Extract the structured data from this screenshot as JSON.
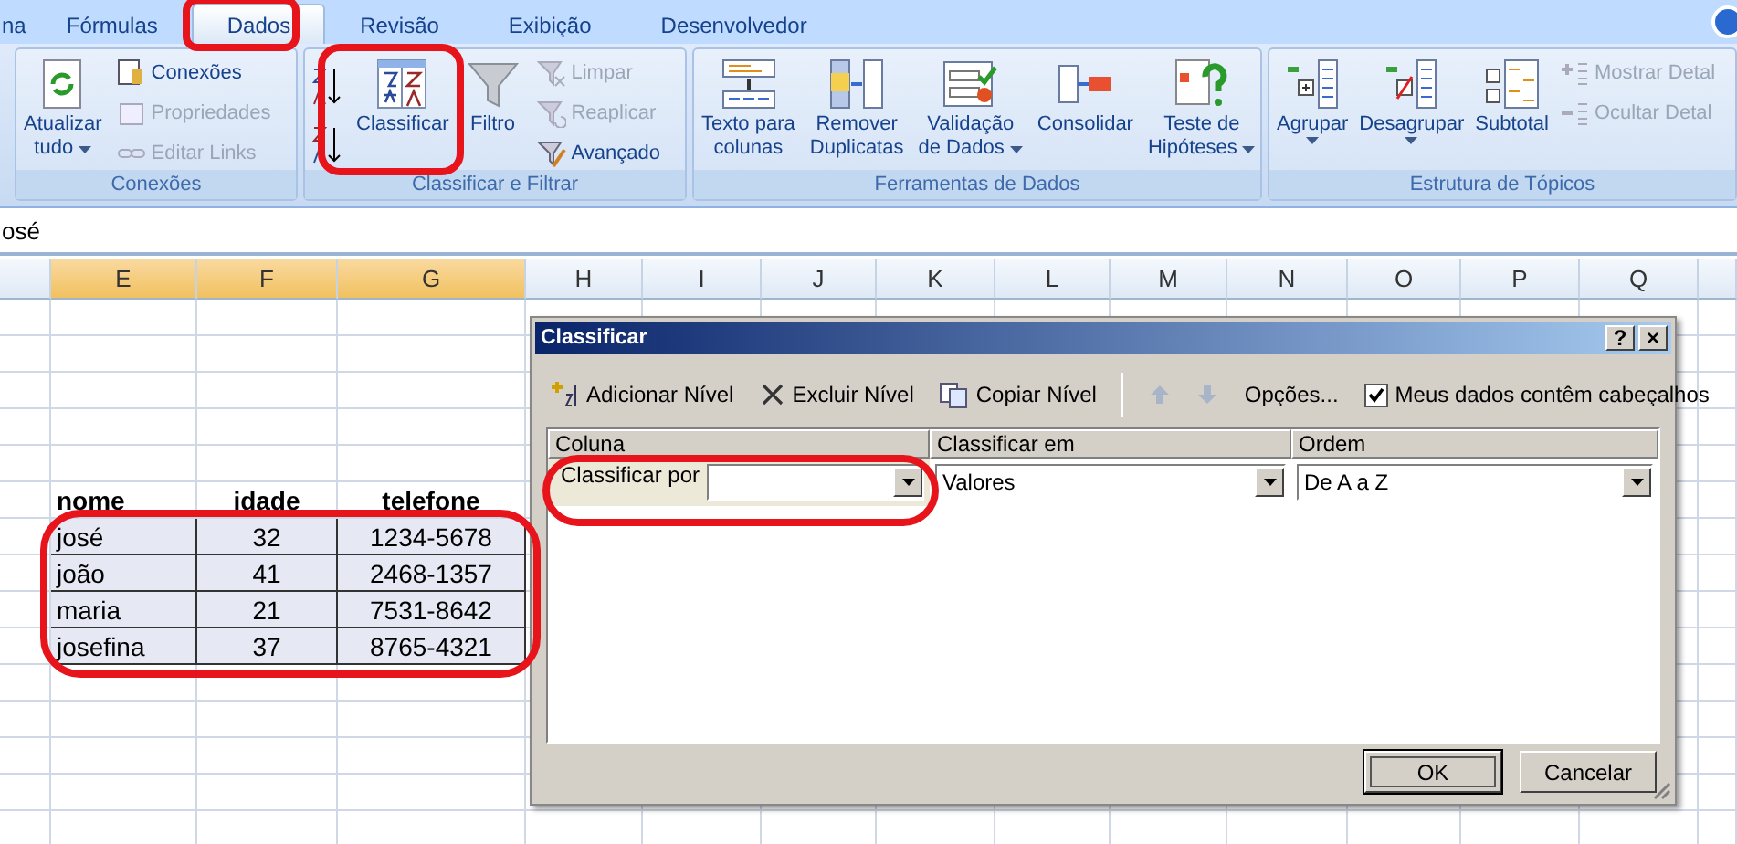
{
  "ribbon_tabs": [
    {
      "label": "na",
      "selected": false
    },
    {
      "label": "Fórmulas",
      "selected": false
    },
    {
      "label": "Dados",
      "selected": true
    },
    {
      "label": "Revisão",
      "selected": false
    },
    {
      "label": "Exibição",
      "selected": false
    },
    {
      "label": "Desenvolvedor",
      "selected": false
    }
  ],
  "ribbon_groups": [
    {
      "label": "Conexões",
      "columns": [
        {
          "kind": "large",
          "lines": [
            "Atualizar",
            "tudo"
          ],
          "menu": true
        },
        {
          "kind": "stack",
          "items": [
            {
              "label": "Conexões",
              "disabled": false
            },
            {
              "label": "Propriedades",
              "disabled": true
            },
            {
              "label": "Editar Links",
              "disabled": true
            }
          ]
        }
      ]
    },
    {
      "label": "Classificar e Filtrar",
      "columns": [
        {
          "kind": "sort_icons"
        },
        {
          "kind": "large",
          "lines": [
            "Classificar"
          ],
          "menu": false
        },
        {
          "kind": "large",
          "lines": [
            "Filtro"
          ],
          "menu": false
        },
        {
          "kind": "stack",
          "items": [
            {
              "label": "Limpar",
              "disabled": true
            },
            {
              "label": "Reaplicar",
              "disabled": true
            },
            {
              "label": "Avançado",
              "disabled": false
            }
          ]
        }
      ]
    },
    {
      "label": "Ferramentas de Dados",
      "columns": [
        {
          "kind": "large",
          "lines": [
            "Texto para",
            "colunas"
          ],
          "menu": false
        },
        {
          "kind": "large",
          "lines": [
            "Remover",
            "Duplicatas"
          ],
          "menu": false
        },
        {
          "kind": "large",
          "lines": [
            "Validação",
            "de Dados"
          ],
          "menu": true
        },
        {
          "kind": "large",
          "lines": [
            "Consolidar"
          ],
          "menu": false
        },
        {
          "kind": "large",
          "lines": [
            "Teste de",
            "Hipóteses"
          ],
          "menu": true
        }
      ]
    },
    {
      "label": "Estrutura de Tópicos",
      "columns": [
        {
          "kind": "large",
          "lines": [
            "Agrupar"
          ],
          "menu": true
        },
        {
          "kind": "large",
          "lines": [
            "Desagrupar"
          ],
          "menu": true
        },
        {
          "kind": "large",
          "lines": [
            "Subtotal"
          ],
          "menu": false
        },
        {
          "kind": "stack",
          "items": [
            {
              "label": "Mostrar Detal",
              "disabled": true
            },
            {
              "label": "Ocultar Detal",
              "disabled": true
            }
          ]
        }
      ]
    }
  ],
  "formula_bar": {
    "value": "osé"
  },
  "sheet": {
    "columns": [
      {
        "label": "E",
        "selected": true
      },
      {
        "label": "F",
        "selected": true
      },
      {
        "label": "G",
        "selected": true
      },
      {
        "label": "H",
        "selected": false
      },
      {
        "label": "I",
        "selected": false
      },
      {
        "label": "J",
        "selected": false
      },
      {
        "label": "K",
        "selected": false
      },
      {
        "label": "L",
        "selected": false
      },
      {
        "label": "M",
        "selected": false
      },
      {
        "label": "N",
        "selected": false
      },
      {
        "label": "O",
        "selected": false
      },
      {
        "label": "P",
        "selected": false
      },
      {
        "label": "Q",
        "selected": false
      }
    ],
    "rows": [
      {
        "kind": "header",
        "selected": false,
        "cells": [
          "nome",
          "idade",
          "telefone"
        ]
      },
      {
        "kind": "data",
        "selected": true,
        "cells": [
          "josé",
          "32",
          "1234-5678"
        ]
      },
      {
        "kind": "data",
        "selected": true,
        "cells": [
          "joão",
          "41",
          "2468-1357"
        ]
      },
      {
        "kind": "data",
        "selected": true,
        "cells": [
          "maria",
          "21",
          "7531-8642"
        ]
      },
      {
        "kind": "data",
        "selected": true,
        "cells": [
          "josefina",
          "37",
          "8765-4321"
        ]
      }
    ]
  },
  "dialog": {
    "title": "Classificar",
    "help": "?",
    "close": "×",
    "toolbar": [
      {
        "kind": "add",
        "label": "Adicionar Nível",
        "disabled": false
      },
      {
        "kind": "delete",
        "label": "Excluir Nível",
        "disabled": false
      },
      {
        "kind": "copy",
        "label": "Copiar Nível",
        "disabled": false
      },
      {
        "kind": "up",
        "disabled": true
      },
      {
        "kind": "down",
        "disabled": true
      },
      {
        "kind": "text",
        "label": "Opções...",
        "disabled": false
      }
    ],
    "header_checkbox": {
      "label": "Meus dados contêm cabeçalhos",
      "checked": true
    },
    "columns": [
      "Coluna",
      "Classificar em",
      "Ordem"
    ],
    "levels": [
      {
        "label": "Classificar por",
        "sort_on": "Valores",
        "order": "De A a Z"
      }
    ],
    "buttons": [
      {
        "label": "OK",
        "default": true
      },
      {
        "label": "Cancelar",
        "default": false
      }
    ]
  }
}
